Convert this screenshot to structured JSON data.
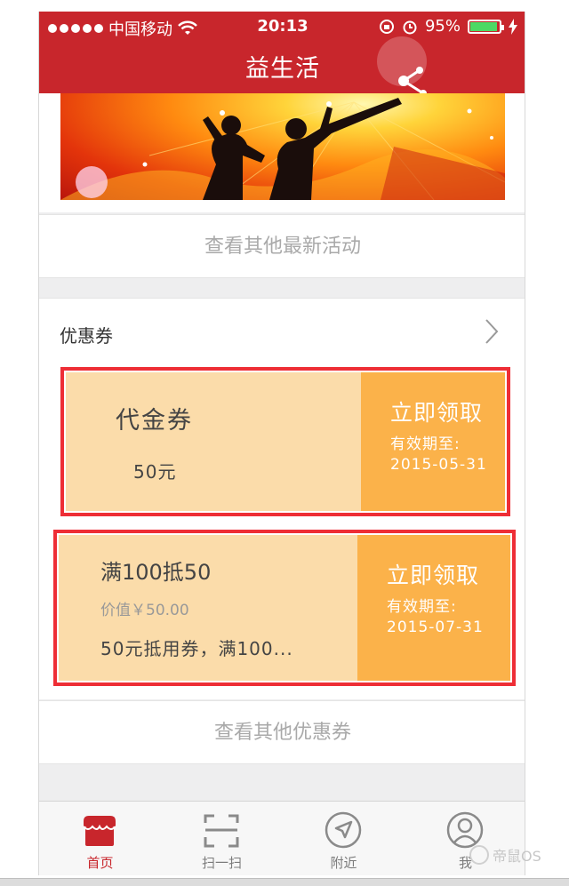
{
  "status_bar": {
    "carrier": "中国移动",
    "time": "20:13",
    "battery": "95%",
    "battery_level": 0.95
  },
  "nav": {
    "title": "益生活"
  },
  "activities": {
    "more_link": "查看其他最新活动"
  },
  "coupons": {
    "section_title": "优惠券",
    "items": [
      {
        "name": "代金券",
        "amount": "50元",
        "claim_label": "立即领取",
        "valid_label": "有效期至:",
        "valid_date": "2015-05-31"
      },
      {
        "name": "满100抵50",
        "value": "价值￥50.00",
        "description": "50元抵用券，满100...",
        "claim_label": "立即领取",
        "valid_label": "有效期至:",
        "valid_date": "2015-07-31"
      }
    ],
    "more_link": "查看其他优惠券"
  },
  "tabbar": {
    "items": [
      {
        "label": "首页",
        "icon": "store-icon",
        "active": true
      },
      {
        "label": "扫一扫",
        "icon": "scan-icon",
        "active": false
      },
      {
        "label": "附近",
        "icon": "location-arrow-icon",
        "active": false
      },
      {
        "label": "我",
        "icon": "user-icon",
        "active": false
      }
    ]
  },
  "watermark": {
    "text": "帝鼠OS"
  },
  "colors": {
    "brand_red": "#c8262c",
    "coupon_left": "#fbdcaa",
    "coupon_right": "#fbb24a",
    "highlight_border": "#ee2e36"
  }
}
